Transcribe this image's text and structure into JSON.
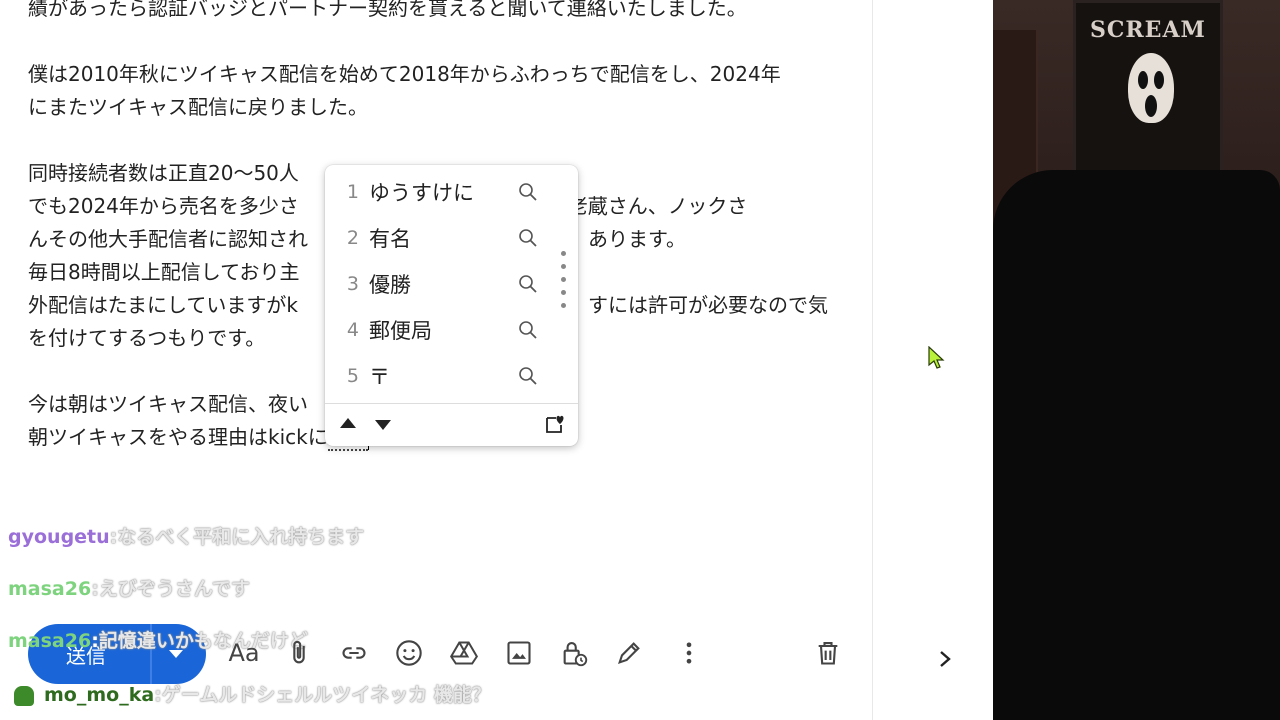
{
  "compose": {
    "lines": [
      "績があったら認証バッジとパートナー契約を貰えると聞いて連絡いたしました。",
      "",
      "僕は2010年秋にツイキャス配信を始めて2018年からふわっちで配信をし、2024年",
      "にまたツイキャス配信に戻りました。",
      "",
      "同時接続者数は正直20〜50人",
      "でも2024年から売名を多少さ",
      "んその他大手配信者に認知され",
      "毎日8時間以上配信しており主",
      "外配信はたまにしていますがk",
      "を付けてするつもりです。",
      "",
      "今は朝はツイキャス配信、夜い"
    ],
    "line2_right": "しや海老蔵さん、ノックさ",
    "line3_right": "あります。",
    "line5_right": "すには許可が必要なので気",
    "last_line_prefix": "朝ツイキャスをやる理由はkickに",
    "last_line_composing": "ゆう"
  },
  "ime": {
    "candidates": [
      {
        "num": "1",
        "word": "ゆうすけに"
      },
      {
        "num": "2",
        "word": "有名"
      },
      {
        "num": "3",
        "word": "優勝"
      },
      {
        "num": "4",
        "word": "郵便局"
      },
      {
        "num": "5",
        "word": "〒"
      }
    ]
  },
  "chat": [
    {
      "user": "gyougetu",
      "sep": ":",
      "msg": "なるべく平和に入れ持ちます",
      "user_color": "#9b6fd8"
    },
    {
      "user": "masa26",
      "sep": ":",
      "msg": "えびぞうさんです",
      "user_color": "#7ed37e"
    },
    {
      "user": "masa26",
      "sep": ":",
      "msg": "記憶違いかもなんだけど",
      "user_color": "#7ed37e"
    },
    {
      "user": "mo_mo_ka",
      "sep": ":",
      "msg": "ゲームルドシェルルツイネッカ 機能？",
      "user_color": "#2e6b1f"
    }
  ],
  "toolbar": {
    "send_label": "送信",
    "format_label": "Aa",
    "icons": [
      "attach-icon",
      "link-icon",
      "emoji-icon",
      "drive-icon",
      "image-icon",
      "confidential-icon",
      "signature-icon",
      "more-options-icon",
      "trash-icon"
    ]
  },
  "webcam": {
    "poster_text": "SCREAM"
  },
  "colors": {
    "accent": "#1a66d8",
    "cursor": "#b8f03a"
  }
}
